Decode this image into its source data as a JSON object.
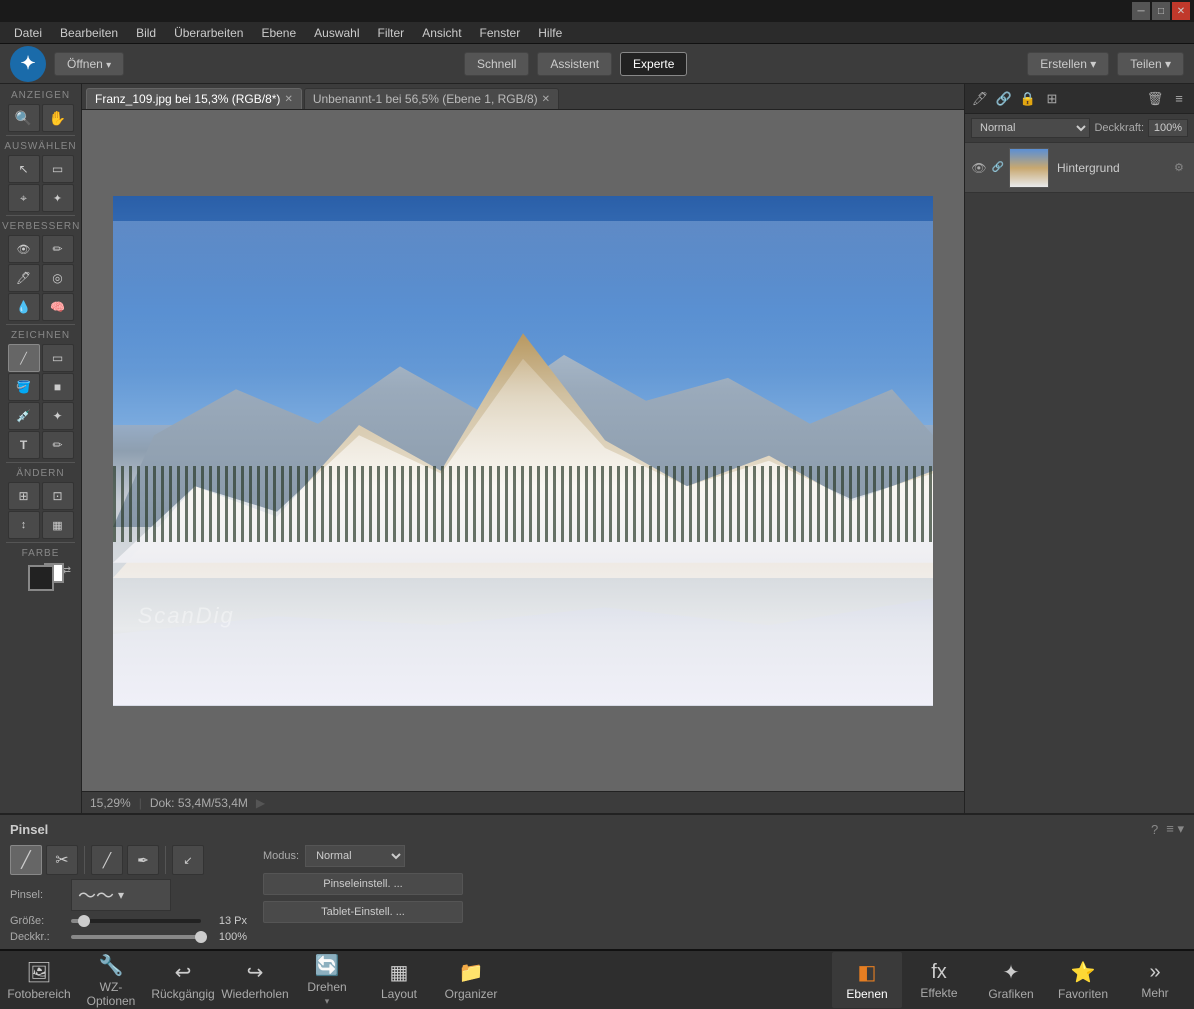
{
  "titlebar": {
    "minimize": "─",
    "maximize": "□",
    "close": "✕"
  },
  "menubar": {
    "items": [
      "Datei",
      "Bearbeiten",
      "Bild",
      "Überarbeiten",
      "Ebene",
      "Auswahl",
      "Filter",
      "Ansicht",
      "Fenster",
      "Hilfe"
    ]
  },
  "top_toolbar": {
    "open_btn": "Öffnen",
    "open_arrow": "▾",
    "schnell": "Schnell",
    "assistent": "Assistent",
    "experte": "Experte",
    "erstellen": "Erstellen",
    "erstellen_arrow": "▾",
    "teilen": "Teilen",
    "teilen_arrow": "▾"
  },
  "tabs": [
    {
      "label": "Franz_109.jpg bei 15,3% (RGB/8*)",
      "active": true
    },
    {
      "label": "Unbenannt-1 bei 56,5% (Ebene 1, RGB/8)",
      "active": false
    }
  ],
  "canvas": {
    "watermark": "ScanDig"
  },
  "status_bar": {
    "zoom": "15,29%",
    "doc": "Dok: 53,4M/53,4M"
  },
  "left_toolbar": {
    "anzeigen": "ANZEIGEN",
    "auswählen": "AUSWÄHLEN",
    "verbessern": "VERBESSERN",
    "zeichnen": "ZEICHNEN",
    "ändern": "ÄNDERN",
    "farbe": "FARBE"
  },
  "layers_panel": {
    "blend_mode": "Normal",
    "opacity_label": "Deckkraft:",
    "opacity_value": "100%",
    "layers": [
      {
        "name": "Hintergrund",
        "visible": true
      }
    ]
  },
  "tool_options": {
    "tool_name": "Pinsel",
    "brush_label": "Pinsel:",
    "size_label": "Größe:",
    "size_value": "13 Px",
    "size_percent": 10,
    "opacity_label": "Deckkr.:",
    "opacity_value": "100%",
    "opacity_percent": 100,
    "mode_label": "Modus:",
    "mode_value": "Normal",
    "pinseleinstell_btn": "Pinseleinstell. ...",
    "tablet_btn": "Tablet-Einstell. ..."
  },
  "bottom_bar": {
    "fotobereich": "Fotobereich",
    "wz_optionen": "WZ-Optionen",
    "rückgängig": "Rückgängig",
    "wiederholen": "Wiederholen",
    "drehen": "Drehen",
    "layout": "Layout",
    "organizer": "Organizer",
    "ebenen": "Ebenen",
    "effekte": "Effekte",
    "grafiken": "Grafiken",
    "favoriten": "Favoriten",
    "mehr": "Mehr"
  }
}
